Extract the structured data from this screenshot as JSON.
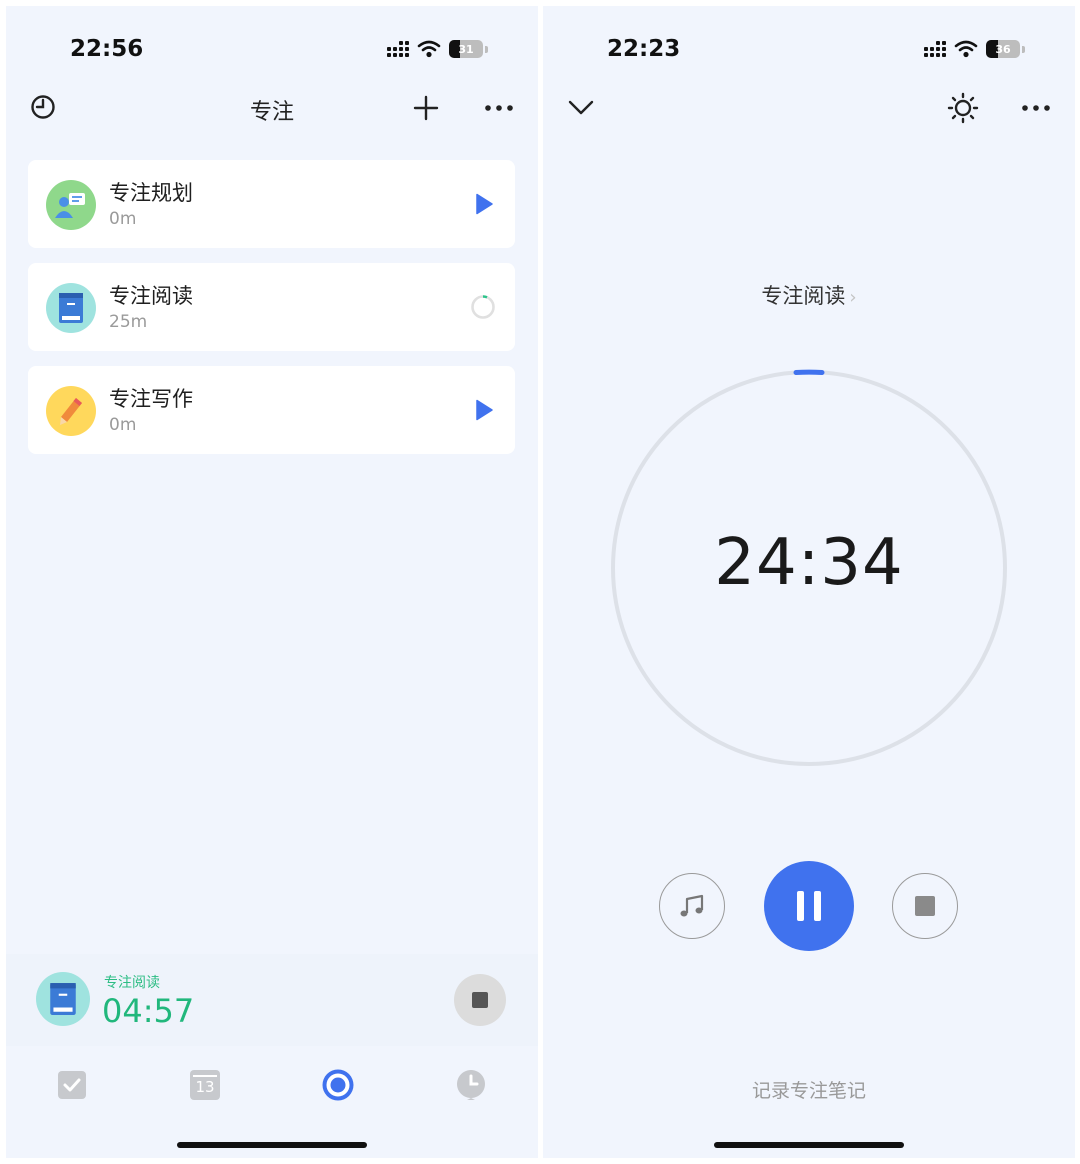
{
  "left_screen": {
    "status_bar": {
      "time": "22:56",
      "battery": "31"
    },
    "nav": {
      "title": "专注"
    },
    "focus_items": [
      {
        "name": "专注规划",
        "duration": "0m",
        "action": "play",
        "icon": "planning-icon"
      },
      {
        "name": "专注阅读",
        "duration": "25m",
        "action": "in-progress-ring",
        "icon": "book-icon"
      },
      {
        "name": "专注写作",
        "duration": "0m",
        "action": "play",
        "icon": "pencil-icon"
      }
    ],
    "mini_player": {
      "label": "专注阅读",
      "time": "04:57"
    },
    "tab_bar": {
      "tabs": [
        {
          "icon": "checkbox-icon",
          "selected": false
        },
        {
          "icon": "calendar-icon",
          "label": "13",
          "selected": false
        },
        {
          "icon": "focus-icon",
          "selected": true
        },
        {
          "icon": "clock-icon",
          "selected": false
        }
      ]
    }
  },
  "right_screen": {
    "status_bar": {
      "time": "22:23",
      "battery": "36"
    },
    "task_name": "专注阅读",
    "timer": "24:34",
    "controls": [
      "music-icon",
      "pause-icon",
      "stop-icon"
    ],
    "note_link": "记录专注笔记"
  },
  "colors": {
    "accent": "#4072ee",
    "background": "#f1f5fd",
    "mini_timer": "#21b77c",
    "ring_track": "#dde1e8"
  }
}
